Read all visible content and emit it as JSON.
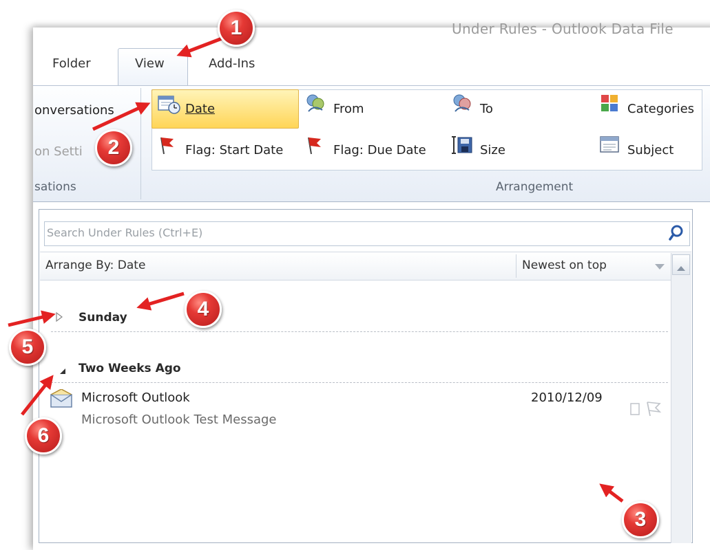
{
  "window": {
    "title": "Under Rules - Outlook Data File"
  },
  "ribbon": {
    "tabs": [
      {
        "label": "Folder"
      },
      {
        "label": "View"
      },
      {
        "label": "Add-Ins"
      }
    ],
    "active_tab": "View",
    "conversations_group": {
      "show_conversations": "onversations",
      "conversation_settings": "on Setti",
      "label": "sations"
    },
    "arrangement_group": {
      "label": "Arrangement",
      "items": [
        {
          "label": "Date",
          "icon": "calendar-clock-icon",
          "selected": true
        },
        {
          "label": "From",
          "icon": "people-icon"
        },
        {
          "label": "To",
          "icon": "people-icon"
        },
        {
          "label": "Categories",
          "icon": "categories-icon"
        },
        {
          "label": "Flag: Start Date",
          "icon": "flag-icon"
        },
        {
          "label": "Flag: Due Date",
          "icon": "flag-icon"
        },
        {
          "label": "Size",
          "icon": "size-icon"
        },
        {
          "label": "Subject",
          "icon": "subject-icon"
        }
      ]
    }
  },
  "search": {
    "placeholder": "Search Under Rules (Ctrl+E)"
  },
  "arrange_bar": {
    "arrange_by": "Arrange By: Date",
    "sort_order": "Newest on top"
  },
  "groups": [
    {
      "name": "Sunday",
      "expanded": false
    },
    {
      "name": "Two Weeks Ago",
      "expanded": true
    }
  ],
  "messages": [
    {
      "from": "Microsoft Outlook",
      "subject": "Microsoft Outlook Test Message",
      "date": "2010/12/09"
    }
  ],
  "callouts": [
    "1",
    "2",
    "3",
    "4",
    "5",
    "6"
  ],
  "colors": {
    "accent": "#ffd557",
    "callout": "#e53935",
    "arrow": "#e32222"
  }
}
